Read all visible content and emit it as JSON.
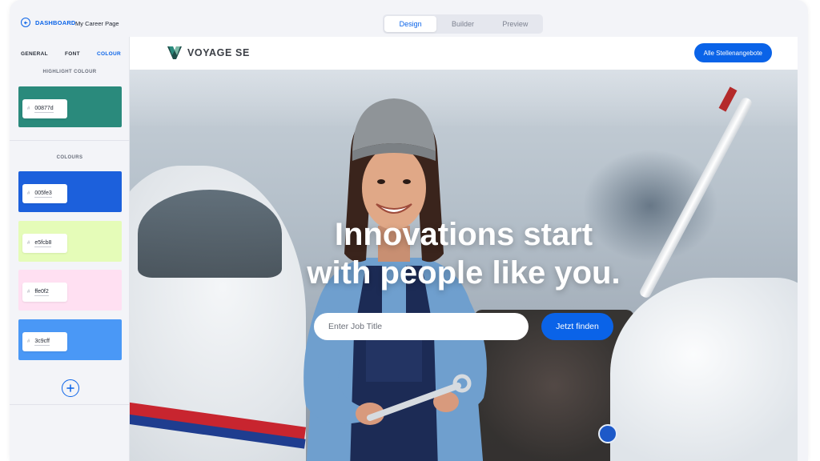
{
  "topbar": {
    "back_label": "DASHBOARD",
    "page_name": "My Career Page",
    "tabs": [
      {
        "label": "Design"
      },
      {
        "label": "Builder"
      },
      {
        "label": "Preview"
      }
    ],
    "active_tab": "Design"
  },
  "sidebar": {
    "tabs": [
      {
        "label": "GENERAL"
      },
      {
        "label": "FONT"
      },
      {
        "label": "COLOUR"
      }
    ],
    "active_tab": "COLOUR",
    "highlight_title": "HIGHLIGHT COLOUR",
    "highlight": {
      "hex": "00877d",
      "color": "#2a8a7c"
    },
    "colours_title": "COLOURS",
    "colours": [
      {
        "hex": "005fe3",
        "color": "#1c60dc"
      },
      {
        "hex": "e5fcb8",
        "color": "#e5fcb8"
      },
      {
        "hex": "ffe0f2",
        "color": "#ffe0f2"
      },
      {
        "hex": "3c9cff",
        "color": "#4a98f6"
      }
    ],
    "hash_symbol": "#"
  },
  "preview": {
    "logo_text": "VOYAGE SE",
    "cta_label": "Alle Stellenangebote",
    "headline_line1": "Innovations start",
    "headline_line2": "with people like you.",
    "search_placeholder": "Enter Job Title",
    "search_button": "Jetzt finden",
    "accent_color": "#0a63e8"
  }
}
